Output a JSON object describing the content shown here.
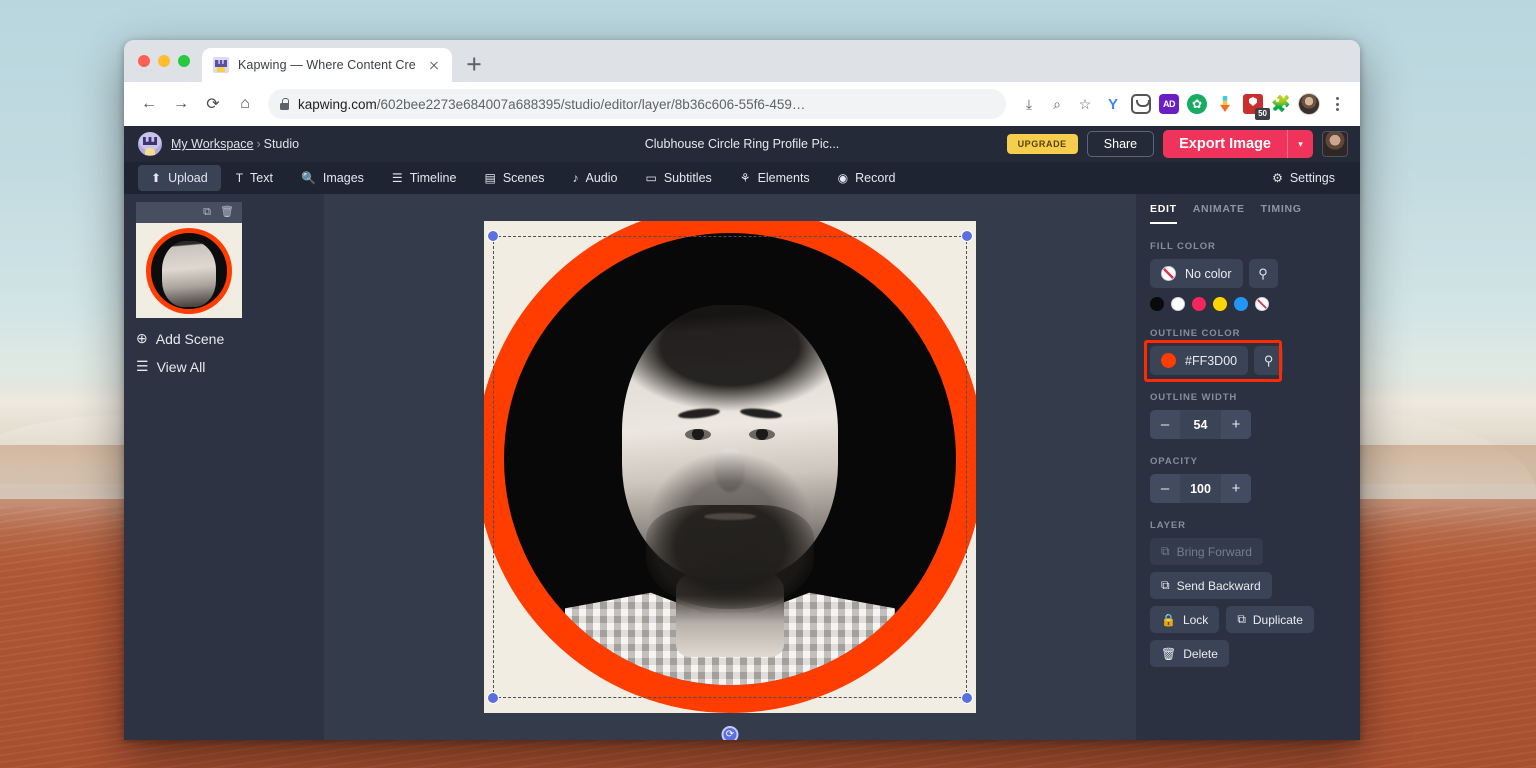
{
  "browser": {
    "tab": {
      "title": "Kapwing — Where Content Cre",
      "favicon": "kapwing-favicon",
      "close": "×"
    },
    "newtab_label": "+",
    "nav": {
      "back": "←",
      "forward": "→",
      "reload": "⟳",
      "home": "⌂"
    },
    "url": {
      "domain": "kapwing.com",
      "path": "/602bee2273e684007a688395/studio/editor/layer/8b36c606-55f6-459…"
    },
    "toolbar_icons": [
      "install-icon",
      "zoom-out-icon",
      "bookmark-star-icon",
      "grammarly-extension-icon",
      "pocket-extension-icon",
      "adblock-extension-icon",
      "privacy-extension-icon",
      "downloader-extension-icon",
      "blocker-extension-icon",
      "extensions-puzzle-icon",
      "profile-avatar-icon",
      "chrome-menu-icon"
    ],
    "blocker_badge": "50"
  },
  "app": {
    "workspace_logo": "kapwing-workspace-logo",
    "breadcrumb": {
      "workspace": "My Workspace",
      "separator": "›",
      "current": "Studio"
    },
    "doc_title": "Clubhouse Circle Ring Profile Pic...",
    "upgrade_label": "UPGRADE",
    "share_label": "Share",
    "export_label": "Export Image",
    "export_caret": "▾",
    "avatar": "user-avatar",
    "toolbar": [
      {
        "label": "Upload",
        "icon": "⬆",
        "icon_name": "upload-icon",
        "active": true
      },
      {
        "label": "Text",
        "icon": "T",
        "icon_name": "text-icon",
        "active": false
      },
      {
        "label": "Images",
        "icon": "🔍",
        "icon_name": "search-icon",
        "active": false
      },
      {
        "label": "Timeline",
        "icon": "☰",
        "icon_name": "timeline-icon",
        "active": false
      },
      {
        "label": "Scenes",
        "icon": "▤",
        "icon_name": "scenes-icon",
        "active": false
      },
      {
        "label": "Audio",
        "icon": "♪",
        "icon_name": "audio-icon",
        "active": false
      },
      {
        "label": "Subtitles",
        "icon": "▭",
        "icon_name": "subtitles-icon",
        "active": false
      },
      {
        "label": "Elements",
        "icon": "⚘",
        "icon_name": "elements-icon",
        "active": false
      },
      {
        "label": "Record",
        "icon": "◉",
        "icon_name": "record-icon",
        "active": false
      }
    ],
    "settings_label": "Settings",
    "settings_icon": "⚙"
  },
  "scenes": {
    "duplicate_icon": "⧉",
    "delete_icon": "🗑",
    "add_scene": {
      "label": "Add Scene",
      "icon": "⊕"
    },
    "view_all": {
      "label": "View All",
      "icon": "☰"
    }
  },
  "canvas": {
    "background_color": "#f2ede3",
    "ring_color": "#ff3d00",
    "rotate_icon": "⟳",
    "handles": [
      "top-left",
      "top-right",
      "bottom-left",
      "bottom-right"
    ]
  },
  "props": {
    "tabs": [
      {
        "label": "EDIT",
        "active": true
      },
      {
        "label": "ANIMATE",
        "active": false
      },
      {
        "label": "TIMING",
        "active": false
      }
    ],
    "fill": {
      "label": "FILL COLOR",
      "value": "No color",
      "eyedropper_icon": "⚲",
      "swatches": [
        "#0a0a0a",
        "#ffffff",
        "#f5255d",
        "#ffd500",
        "#2196f3",
        "no-color"
      ]
    },
    "outline": {
      "label": "OUTLINE COLOR",
      "value": "#FF3D00",
      "color": "#ff3d00",
      "eyedropper_icon": "⚲",
      "highlighted": true
    },
    "outline_width": {
      "label": "OUTLINE WIDTH",
      "value": "54",
      "minus": "–",
      "plus": "+"
    },
    "opacity": {
      "label": "OPACITY",
      "value": "100",
      "minus": "–",
      "plus": "+"
    },
    "layer": {
      "label": "LAYER",
      "buttons": [
        {
          "label": "Bring Forward",
          "icon": "⧉",
          "icon_name": "bring-forward-icon",
          "disabled": true
        },
        {
          "label": "Send Backward",
          "icon": "⧉",
          "icon_name": "send-backward-icon",
          "disabled": false
        },
        {
          "label": "Lock",
          "icon": "🔒",
          "icon_name": "lock-icon",
          "disabled": false
        },
        {
          "label": "Duplicate",
          "icon": "⧉",
          "icon_name": "duplicate-icon",
          "disabled": false
        },
        {
          "label": "Delete",
          "icon": "🗑",
          "icon_name": "trash-icon",
          "disabled": false
        }
      ]
    }
  },
  "annotation": {
    "color": "#ff2a00",
    "target": "outline-color-field"
  }
}
